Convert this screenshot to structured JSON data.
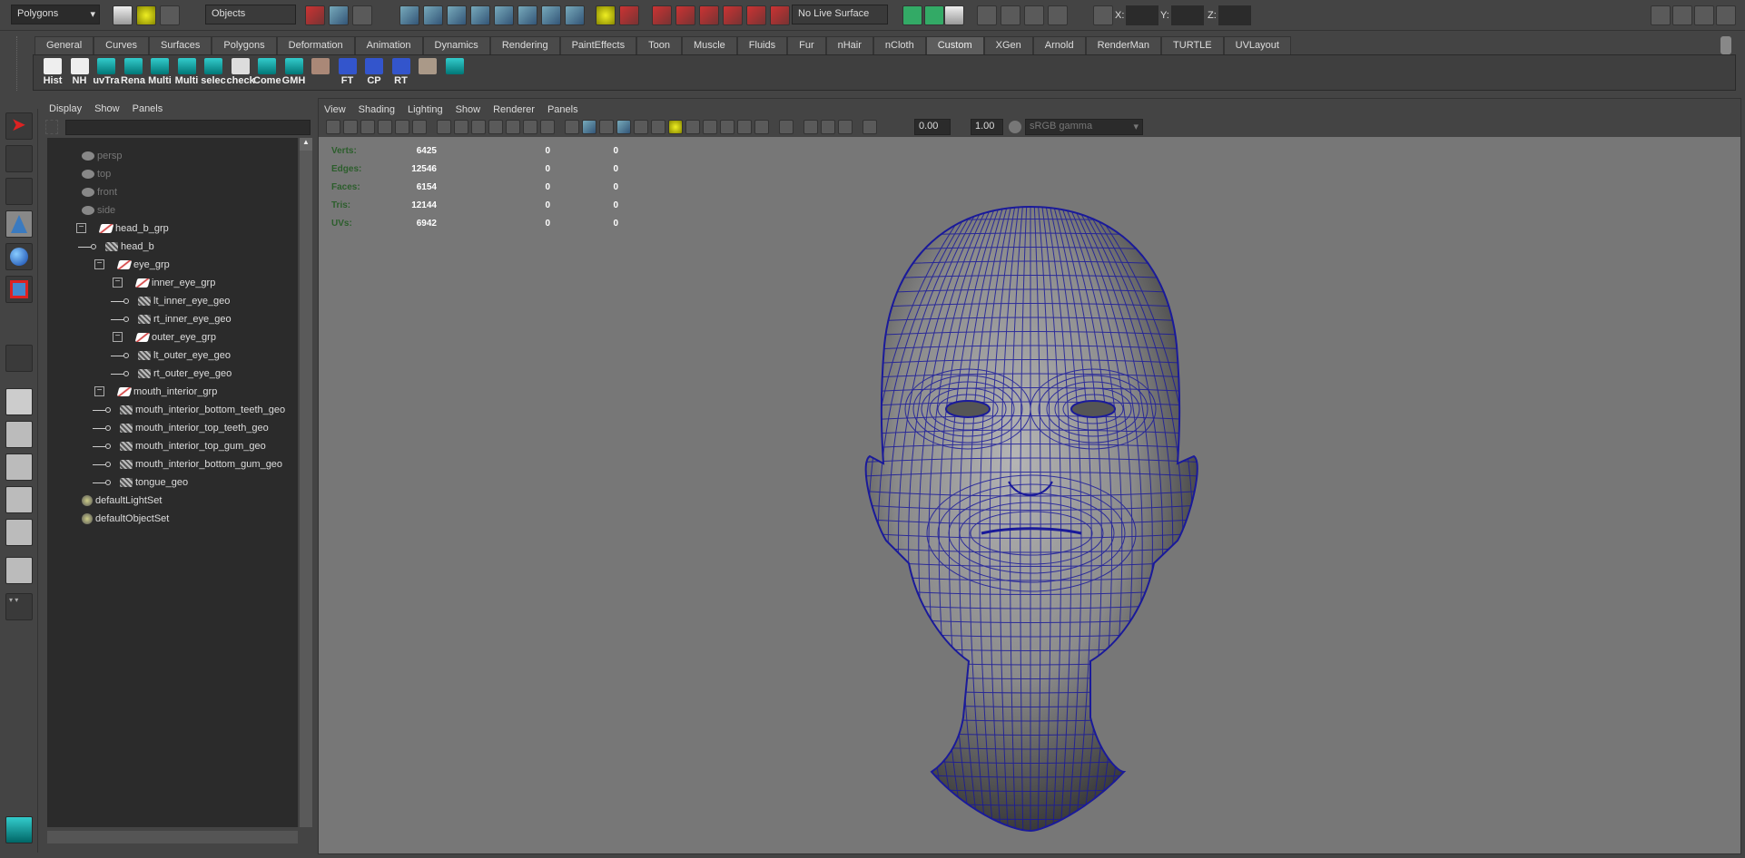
{
  "topbar": {
    "menuset": "Polygons",
    "selection_mode": "Objects",
    "live_surface": "No Live Surface",
    "x_label": "X:",
    "y_label": "Y:",
    "z_label": "Z:"
  },
  "shelf": {
    "tabs": [
      "General",
      "Curves",
      "Surfaces",
      "Polygons",
      "Deformation",
      "Animation",
      "Dynamics",
      "Rendering",
      "PaintEffects",
      "Toon",
      "Muscle",
      "Fluids",
      "Fur",
      "nHair",
      "nCloth",
      "Custom",
      "XGen",
      "Arnold",
      "RenderMan",
      "TURTLE",
      "UVLayout"
    ],
    "active_tab": "Custom",
    "buttons": [
      "Hist",
      "NH",
      "uvTra",
      "Rena",
      "Multi",
      "Multi",
      "selec",
      "check",
      "Come",
      "GMH",
      "",
      "FT",
      "CP",
      "RT",
      "",
      ""
    ]
  },
  "outliner": {
    "menus": [
      "Display",
      "Show",
      "Panels"
    ],
    "filter_placeholder": "",
    "items": [
      {
        "label": "persp",
        "type": "cam",
        "depth": 0
      },
      {
        "label": "top",
        "type": "cam",
        "depth": 0
      },
      {
        "label": "front",
        "type": "cam",
        "depth": 0
      },
      {
        "label": "side",
        "type": "cam",
        "depth": 0
      },
      {
        "label": "head_b_grp",
        "type": "grp",
        "depth": 0,
        "expanded": true
      },
      {
        "label": "head_b",
        "type": "mesh",
        "depth": 1
      },
      {
        "label": "eye_grp",
        "type": "grp",
        "depth": 1,
        "expanded": true
      },
      {
        "label": "inner_eye_grp",
        "type": "grp",
        "depth": 2,
        "expanded": true
      },
      {
        "label": "lt_inner_eye_geo",
        "type": "mesh",
        "depth": 3
      },
      {
        "label": "rt_inner_eye_geo",
        "type": "mesh",
        "depth": 3
      },
      {
        "label": "outer_eye_grp",
        "type": "grp",
        "depth": 2,
        "expanded": true
      },
      {
        "label": "lt_outer_eye_geo",
        "type": "mesh",
        "depth": 3
      },
      {
        "label": "rt_outer_eye_geo",
        "type": "mesh",
        "depth": 3
      },
      {
        "label": "mouth_interior_grp",
        "type": "grp",
        "depth": 1,
        "expanded": true
      },
      {
        "label": "mouth_interior_bottom_teeth_geo",
        "type": "mesh",
        "depth": 2
      },
      {
        "label": "mouth_interior_top_teeth_geo",
        "type": "mesh",
        "depth": 2
      },
      {
        "label": "mouth_interior_top_gum_geo",
        "type": "mesh",
        "depth": 2
      },
      {
        "label": "mouth_interior_bottom_gum_geo",
        "type": "mesh",
        "depth": 2
      },
      {
        "label": "tongue_geo",
        "type": "mesh",
        "depth": 2
      },
      {
        "label": "defaultLightSet",
        "type": "set",
        "depth": 0
      },
      {
        "label": "defaultObjectSet",
        "type": "set",
        "depth": 0
      }
    ]
  },
  "viewport": {
    "menus": [
      "View",
      "Shading",
      "Lighting",
      "Show",
      "Renderer",
      "Panels"
    ],
    "exposure": "0.00",
    "gamma": "1.00",
    "color_space": "sRGB gamma",
    "stats": [
      {
        "label": "Verts:",
        "values": [
          "6425",
          "0",
          "0"
        ]
      },
      {
        "label": "Edges:",
        "values": [
          "12546",
          "0",
          "0"
        ]
      },
      {
        "label": "Faces:",
        "values": [
          "6154",
          "0",
          "0"
        ]
      },
      {
        "label": "Tris:",
        "values": [
          "12144",
          "0",
          "0"
        ]
      },
      {
        "label": "UVs:",
        "values": [
          "6942",
          "0",
          "0"
        ]
      }
    ]
  },
  "colors": {
    "wireframe": "#1a1a9a",
    "viewport_bg": "#777777",
    "panel_bg": "#444444"
  }
}
